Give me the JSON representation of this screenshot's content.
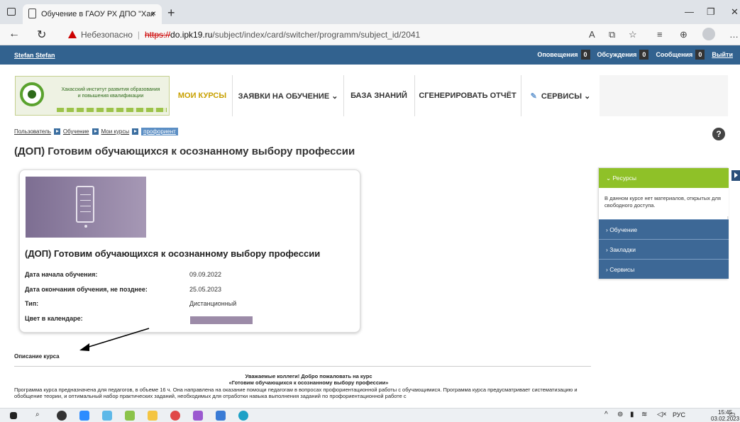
{
  "browser": {
    "tab_title": "Обучение в ГАОУ РХ ДПО \"Хак",
    "not_secure": "Небезопасно",
    "url_scheme": "https://",
    "url_host": "do.ipk19.ru",
    "url_path": "/subject/index/card/switcher/programm/subject_id/2041",
    "new_tab": "+",
    "close": "×"
  },
  "topbar": {
    "user": "Stefan Stefan",
    "notifications_label": "Оповещения",
    "notifications_count": "0",
    "discussions_label": "Обсуждения",
    "discussions_count": "0",
    "messages_label": "Сообщения",
    "messages_count": "0",
    "logout": "Выйти"
  },
  "logo": {
    "line1": "Хакасский институт развития образования",
    "line2": "и повышения квалификации"
  },
  "menu": {
    "my_courses": "МОИ КУРСЫ",
    "applications": "ЗАЯВКИ НА ОБУЧЕНИЕ ⌄",
    "knowledge": "БАЗА ЗНАНИЙ",
    "report": "СГЕНЕРИРОВАТЬ ОТЧЁТ",
    "services": "СЕРВИСЫ ⌄"
  },
  "breadcrumb": {
    "user": "Пользователь",
    "learning": "Обучение",
    "my_courses": "Мои курсы",
    "current": "профориент"
  },
  "page_title": "(ДОП) Готовим обучающихся к осознанному выбору профессии",
  "card": {
    "title": "(ДОП) Готовим обучающихся к осознанному выбору профессии",
    "start_label": "Дата начала обучения:",
    "start_value": "09.09.2022",
    "end_label": "Дата окончания обучения, не позднее:",
    "end_value": "25.05.2023",
    "type_label": "Тип:",
    "type_value": "Дистанционный",
    "color_label": "Цвет в календаре:",
    "color_value": "#9c8ba8"
  },
  "description": {
    "heading": "Описание курса",
    "welcome1": "Уважаемые коллеги! Добро пожаловать на курс",
    "welcome2": "«Готовим обучающихся к осознанному выбору профессии»",
    "para": "Программа курса предназначена для педагогов, в объеме 16 ч. Она направлена на оказание помощи педагогам в вопросах профориентационной работы с обучающимися. Программа курса предусматривает систематизацию и обобщение теории, и оптимальный набор практических заданий, необходимых для отработки навыка выполнения заданий по профориентационной работе с"
  },
  "panel": {
    "resources": "⌄  Ресурсы",
    "resources_text": "В данном курсе нет материалов, открытых для свободного доступа.",
    "learning": "›  Обучение",
    "bookmarks": "›  Закладки",
    "services": "›  Сервисы"
  },
  "taskbar": {
    "lang": "РУС",
    "time": "15:45",
    "date": "03.02.2023"
  }
}
